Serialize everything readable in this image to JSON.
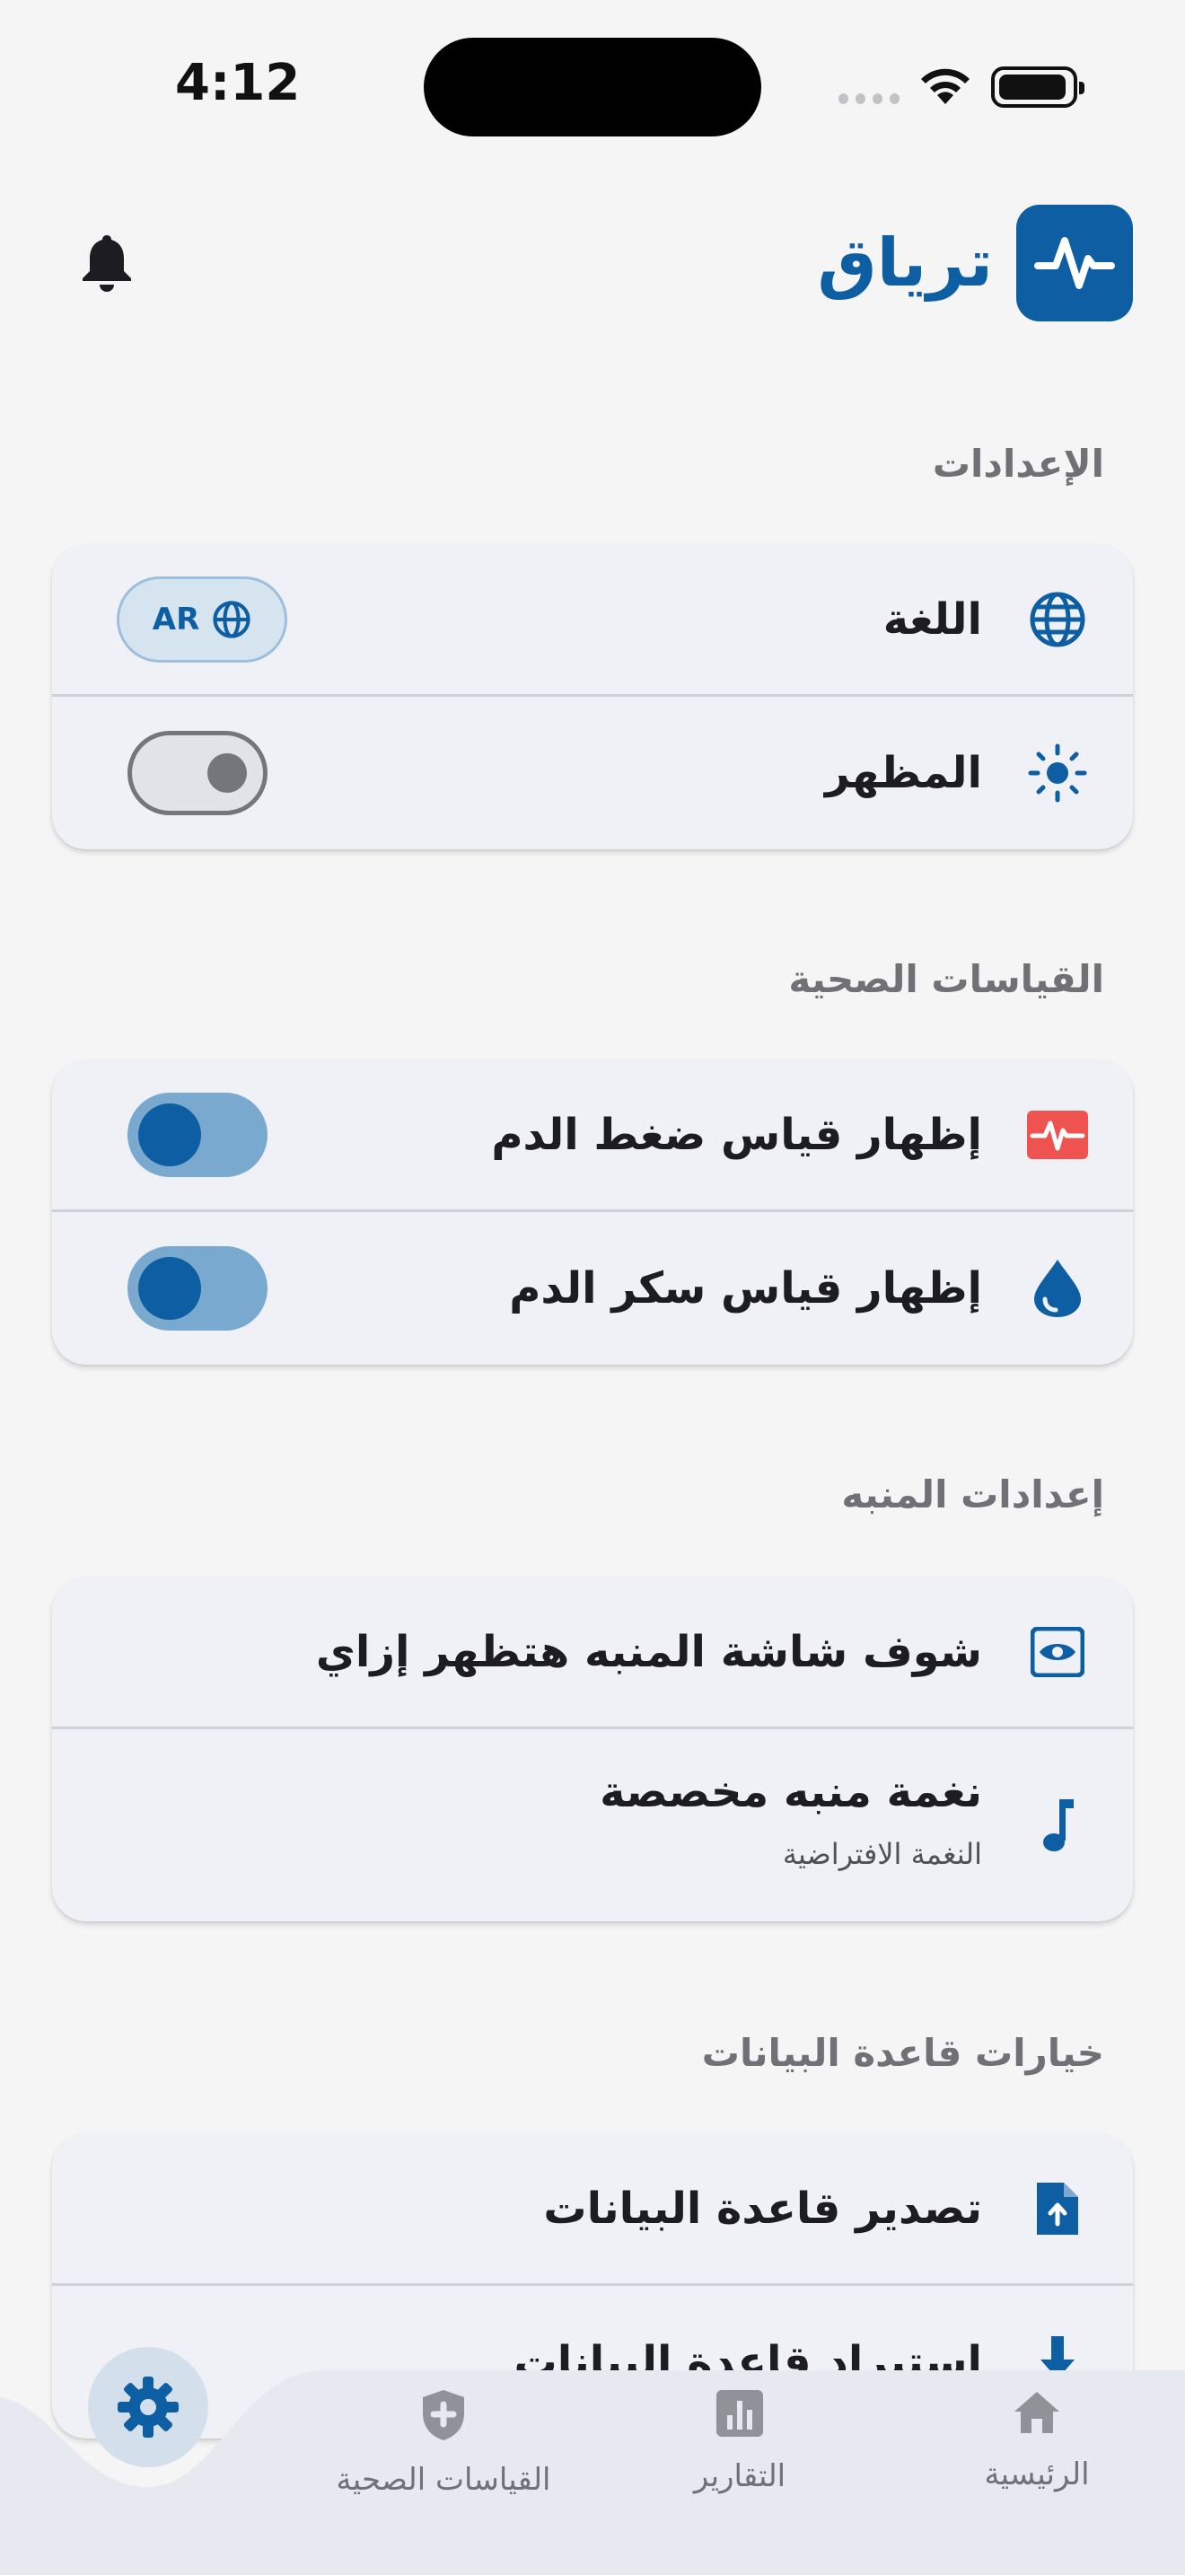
{
  "status": {
    "time": "4:12"
  },
  "header": {
    "app_name": "ترياق"
  },
  "sections": {
    "settings": {
      "title": "الإعدادات",
      "language_label": "اللغة",
      "language_code": "AR",
      "appearance_label": "المظهر",
      "appearance_toggle_on": false
    },
    "health": {
      "title": "القياسات الصحية",
      "bp_label": "إظهار قياس ضغط الدم",
      "bp_toggle_on": true,
      "sugar_label": "إظهار قياس سكر الدم",
      "sugar_toggle_on": true
    },
    "alarm": {
      "title": "إعدادات المنبه",
      "preview_label": "شوف شاشة المنبه هتظهر إزاي",
      "tone_label": "نغمة منبه مخصصة",
      "tone_value": "النغمة الافتراضية"
    },
    "database": {
      "title": "خيارات قاعدة البيانات",
      "export_label": "تصدير قاعدة البيانات",
      "import_label": "استيراد قاعدة البيانات"
    }
  },
  "nav": {
    "home": "الرئيسية",
    "reports": "التقارير",
    "health": "القياسات الصحية",
    "settings_active": true
  },
  "colors": {
    "brand": "#0e5ea3",
    "bp_icon": "#ef5350",
    "card_bg": "#eff1f6",
    "nav_bg": "#e6e9ef"
  }
}
